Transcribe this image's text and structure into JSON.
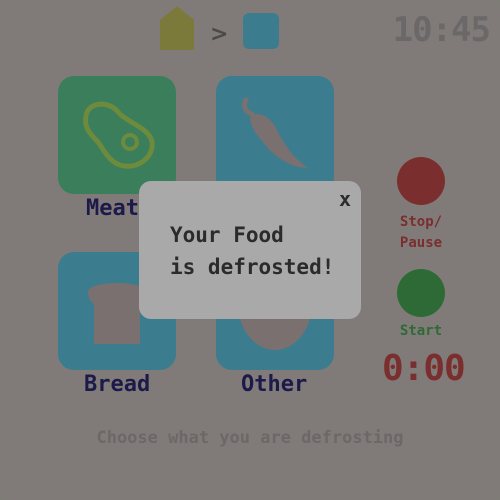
{
  "header": {
    "home_icon": "home-icon",
    "separator": ">",
    "time": "10:45"
  },
  "tiles": [
    {
      "name": "meat",
      "label": "Meat",
      "icon": "steak-icon"
    },
    {
      "name": "vegetables",
      "label": "",
      "icon": "pepper-icon"
    },
    {
      "name": "bread",
      "label": "Bread",
      "icon": "bread-icon"
    },
    {
      "name": "other",
      "label": "Other",
      "icon": "bowl-icon"
    }
  ],
  "controls": {
    "stop_label": "Stop/\nPause",
    "start_label": "Start",
    "timer": "0:00"
  },
  "instructions": "Choose what you are defrosting",
  "modal": {
    "close_label": "x",
    "message": "Your Food\nis defrosted!"
  },
  "colors": {
    "meat_tile": "#3a7e5c",
    "blue_tile": "#3b7d8e",
    "stop": "#7a2e2e",
    "start": "#2e6a35"
  }
}
